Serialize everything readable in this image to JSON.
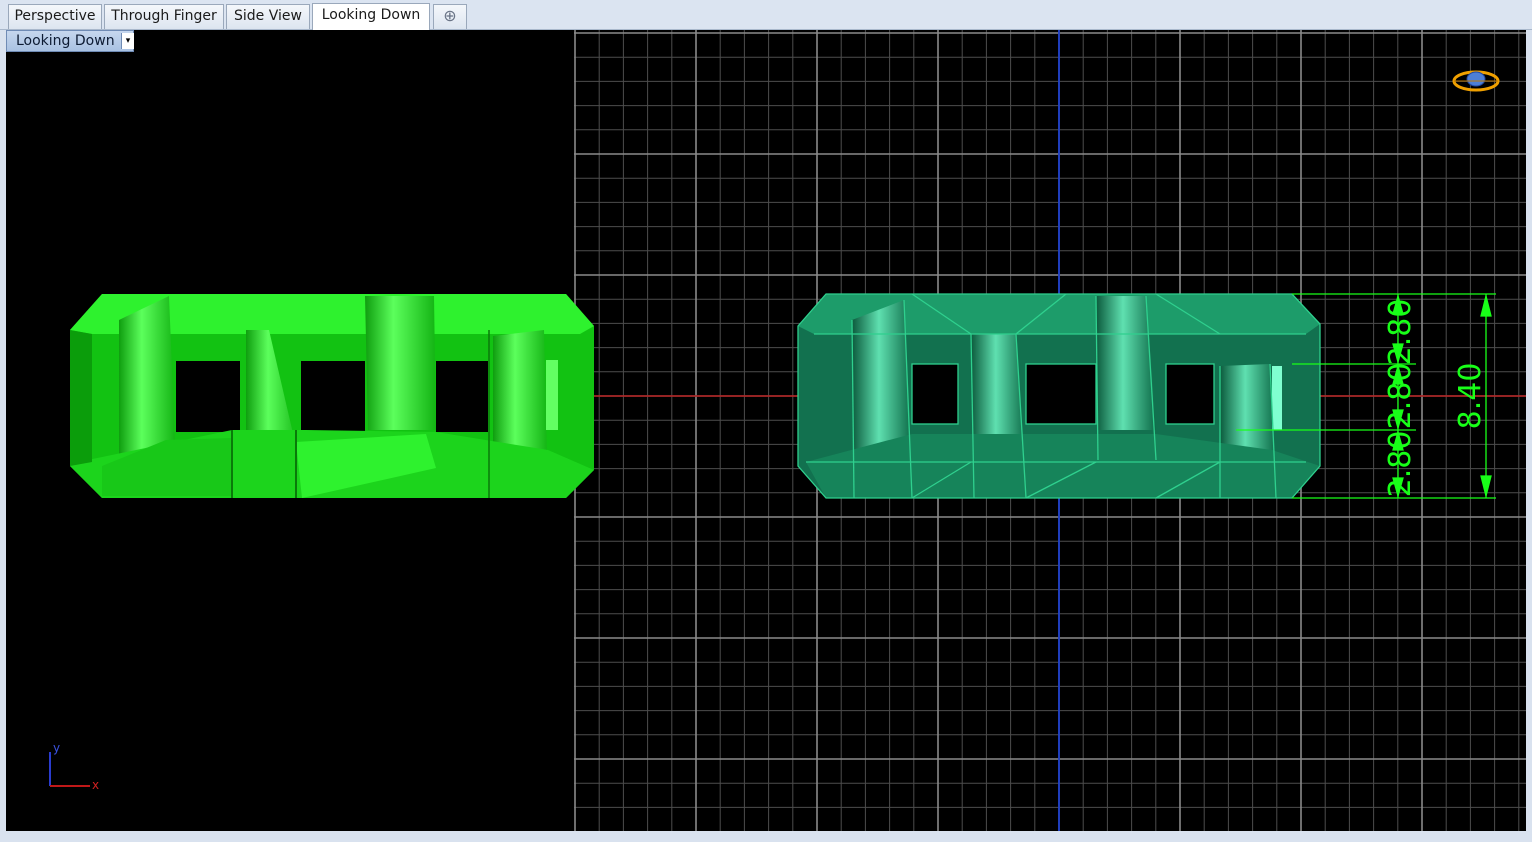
{
  "tabs": [
    {
      "label": "Perspective",
      "active": false
    },
    {
      "label": "Through Finger",
      "active": false
    },
    {
      "label": "Side View",
      "active": false
    },
    {
      "label": "Looking Down",
      "active": true
    }
  ],
  "add_tab_symbol": "⊕",
  "viewport": {
    "label": "Looking Down",
    "dropdown_symbol": "▾"
  },
  "dimensions": {
    "top": "2.80",
    "middle": "2.80",
    "bottom": "2.80",
    "total": "8.40"
  },
  "axis": {
    "x": "x",
    "y": "y"
  },
  "colors": {
    "shaded": "#21e321",
    "wire": "#1d9a64",
    "dimension": "#18ff18",
    "grid": "#7b7b7b",
    "x_axis": "#b01818",
    "y_axis": "#1a3cc8"
  },
  "icons": [
    "gumball-ring-icon",
    "world-axes-icon"
  ]
}
